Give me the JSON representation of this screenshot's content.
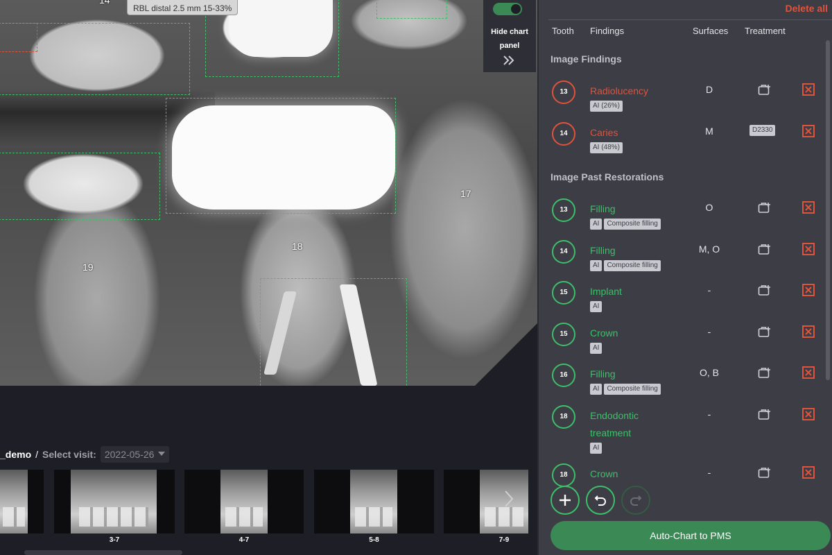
{
  "viewer": {
    "tooltip": "RBL distal 2.5 mm 15-33%",
    "tooth_numbers": [
      "14",
      "19",
      "18",
      "17"
    ],
    "chart_toggle": {
      "label": "Hide chart panel",
      "on": true
    }
  },
  "visit": {
    "patient": "_demo",
    "slash": "/",
    "label": "Select visit:",
    "selected": "2022-05-26"
  },
  "thumbnails": [
    "",
    "3-7",
    "4-7",
    "5-8",
    "7-9"
  ],
  "panel": {
    "delete_all": "Delete all",
    "columns": {
      "tooth": "Tooth",
      "findings": "Findings",
      "surfaces": "Surfaces",
      "treatment": "Treatment"
    },
    "image_findings_title": "Image Findings",
    "image_findings": [
      {
        "tooth": "13",
        "name": "Radiolucency",
        "tags": [
          "AI (26%)"
        ],
        "surfaces": "D",
        "treatment": ""
      },
      {
        "tooth": "14",
        "name": "Caries",
        "tags": [
          "AI (48%)"
        ],
        "surfaces": "M",
        "treatment": "D2330"
      }
    ],
    "restorations_title": "Image Past Restorations",
    "restorations": [
      {
        "tooth": "13",
        "name": "Filling",
        "tags": [
          "AI",
          "Composite filling"
        ],
        "surfaces": "O"
      },
      {
        "tooth": "14",
        "name": "Filling",
        "tags": [
          "AI",
          "Composite filling"
        ],
        "surfaces": "M, O"
      },
      {
        "tooth": "15",
        "name": "Implant",
        "tags": [
          "AI"
        ],
        "surfaces": "-"
      },
      {
        "tooth": "15",
        "name": "Crown",
        "tags": [
          "AI"
        ],
        "surfaces": "-"
      },
      {
        "tooth": "16",
        "name": "Filling",
        "tags": [
          "AI",
          "Composite filling"
        ],
        "surfaces": "O, B"
      },
      {
        "tooth": "18",
        "name": "Endodontic treatment",
        "tags": [
          "AI"
        ],
        "surfaces": "-"
      },
      {
        "tooth": "18",
        "name": "Crown",
        "tags": [],
        "surfaces": "-"
      }
    ],
    "auto_chart": "Auto-Chart to PMS",
    "icons": {
      "add": "plus-icon",
      "undo": "undo-icon",
      "redo": "redo-icon",
      "add_treatment": "add-treatment-icon",
      "delete": "close-box-icon"
    },
    "colors": {
      "finding_red": "#e0533c",
      "restoration_green": "#3fbf6a",
      "primary_button": "#3b8a56"
    }
  }
}
